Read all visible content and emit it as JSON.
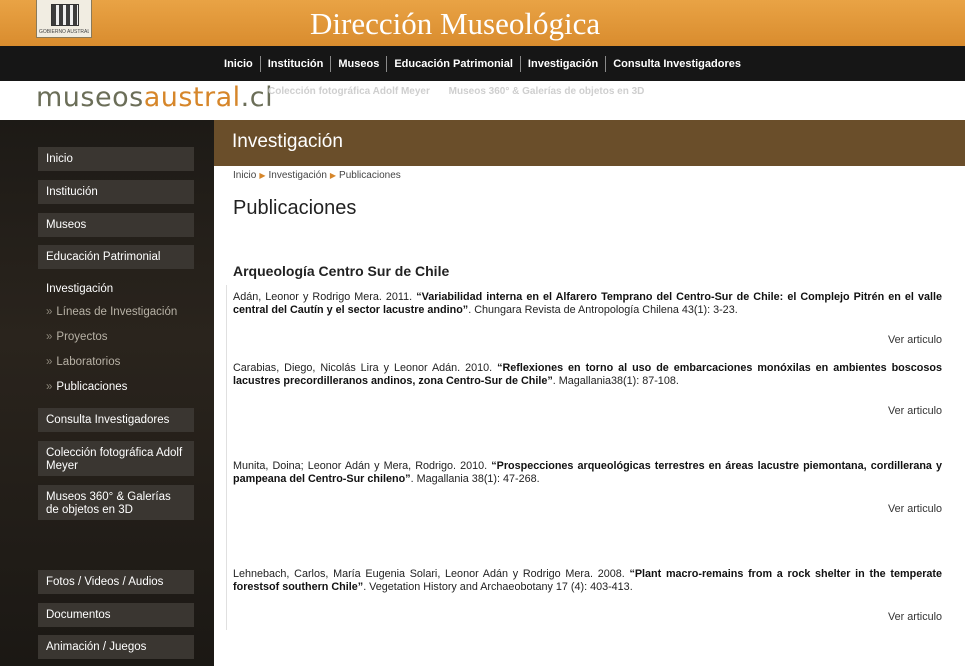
{
  "header": {
    "title": "Dirección Museológica",
    "crest_text": "GOBIERNO AUSTRAL DE CHILE"
  },
  "topnav": [
    "Inicio",
    "Institución",
    "Museos",
    "Educación Patrimonial",
    "Investigación",
    "Consulta Investigadores"
  ],
  "logo": {
    "part1": "museos",
    "part2": "austral",
    "part3": ".cl"
  },
  "sublinks": [
    "Colección fotográfica Adolf Meyer",
    "Museos 360° & Galerías de objetos en 3D"
  ],
  "sidebar": {
    "items": [
      "Inicio",
      "Institución",
      "Museos",
      "Educación Patrimonial",
      "Investigación"
    ],
    "subitems": [
      "Líneas de Investigación",
      "Proyectos",
      "Laboratorios",
      "Publicaciones"
    ],
    "items2": [
      "Consulta Investigadores",
      "Colección fotográfica Adolf Meyer",
      "Museos 360° & Galerías de objetos en 3D"
    ],
    "items3": [
      "Fotos / Videos / Audios",
      "Documentos",
      "Animación / Juegos"
    ],
    "sep": "»"
  },
  "section": {
    "title": "Investigación"
  },
  "breadcrumb": [
    "Inicio",
    "Investigación",
    "Publicaciones"
  ],
  "page_title": "Publicaciones",
  "sub_title": "Arqueología Centro Sur de Chile",
  "entries": [
    {
      "authors": "Adán, Leonor y Rodrigo Mera. 2011.",
      "title": "“Variabilidad interna en el Alfarero Temprano del Centro-Sur de Chile: el Complejo Pitrén en el valle central del Cautín y el sector lacustre andino”",
      "source": ". Chungara Revista de Antropología Chilena 43(1): 3-23.",
      "link": "Ver articulo"
    },
    {
      "authors": "Carabias, Diego, Nicolás Lira y Leonor Adán. 2010.",
      "title": "“Reflexiones en torno al uso de embarcaciones monóxilas en ambientes boscosos lacustres precordilleranos andinos, zona Centro-Sur de Chile”",
      "source": ". Magallania38(1): 87-108.",
      "link": "Ver articulo"
    },
    {
      "authors": "Munita, Doina; Leonor Adán y Mera, Rodrigo. 2010.",
      "title": "“Prospecciones arqueológicas terrestres en áreas lacustre piemontana, cordillerana y pampeana del Centro-Sur chileno”",
      "source": ". Magallania 38(1): 47-268.",
      "link": "Ver articulo"
    },
    {
      "authors": "Lehnebach, Carlos, María Eugenia Solari, Leonor Adán y Rodrigo Mera. 2008.",
      "title": "“Plant macro-remains from a rock shelter in the temperate forestsof southern Chile”",
      "source": ". Vegetation History and Archaeobotany 17 (4): 403-413.",
      "link": "Ver articulo"
    }
  ]
}
